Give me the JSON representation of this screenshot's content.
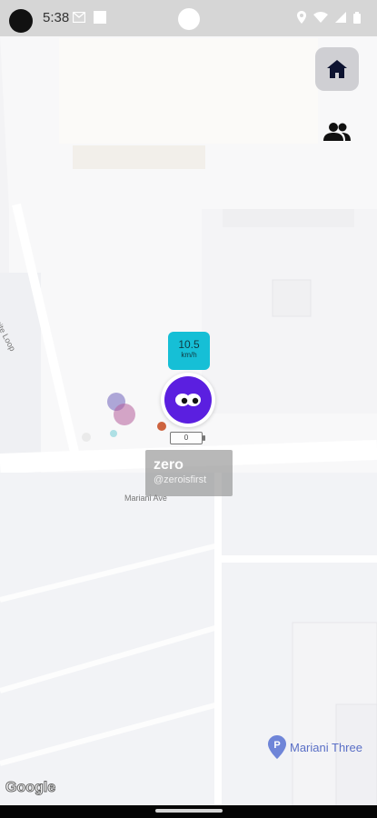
{
  "status_bar": {
    "time": "5:38"
  },
  "header": {
    "home_icon": "home-icon",
    "friends_icon": "people-icon"
  },
  "map": {
    "street_labels": {
      "infinite_loop": "Infinite Loop",
      "mariani_ave": "Mariani Ave"
    },
    "poi": {
      "label": "Mariani Three"
    },
    "attribution": "Google"
  },
  "user_marker": {
    "speed_value": "10.5",
    "speed_unit": "km/h",
    "battery": "0",
    "name": "zero",
    "handle": "@zeroisfirst"
  },
  "colors": {
    "avatar_bg": "#5b1fe0",
    "speed_badge_bg": "#16bfd6",
    "poi": "#5a6fc6"
  }
}
